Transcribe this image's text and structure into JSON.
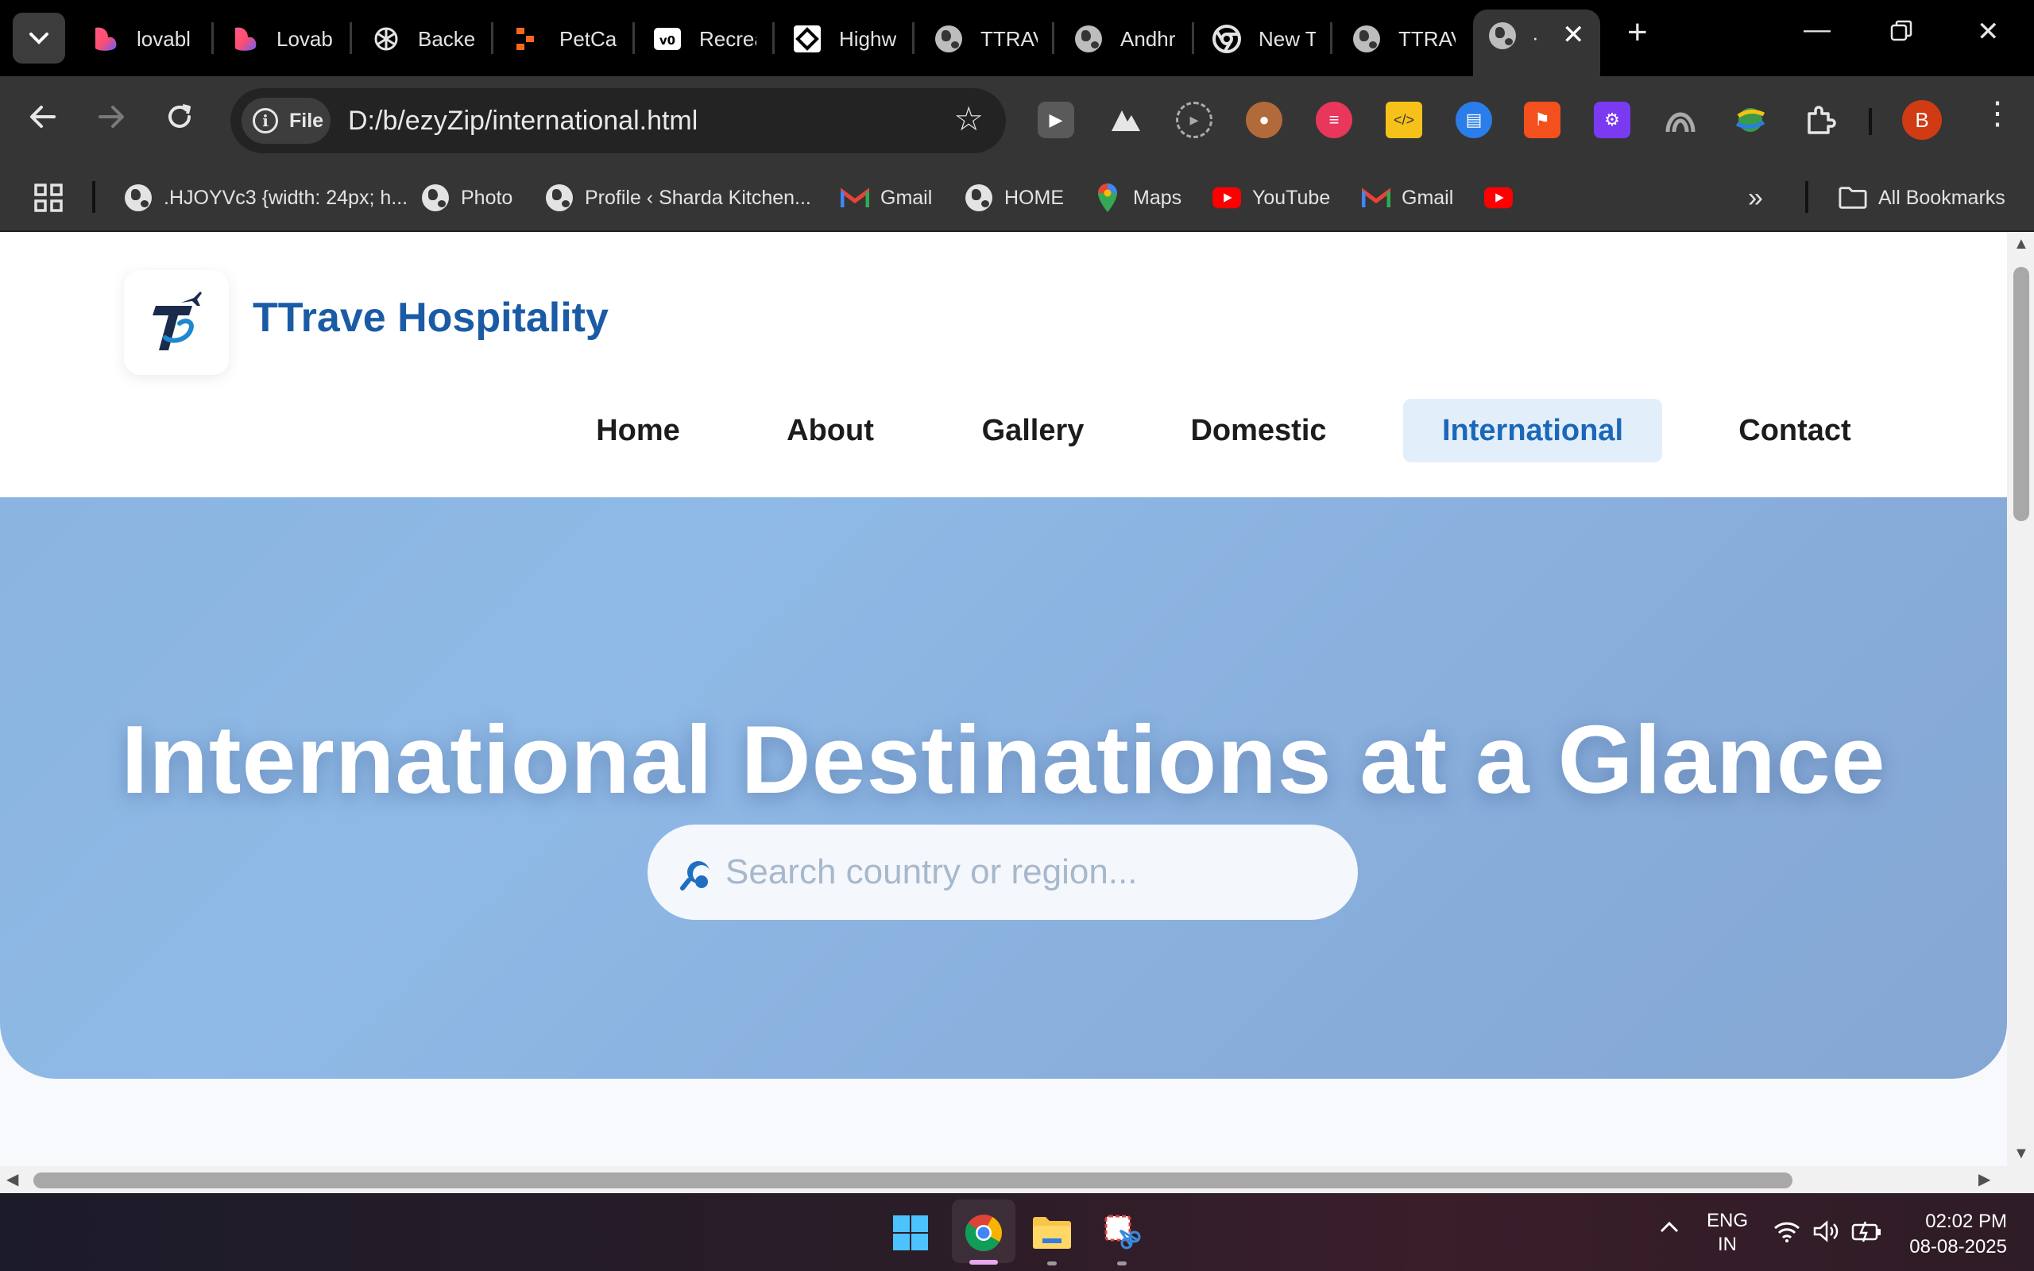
{
  "browser": {
    "tabs": [
      {
        "title": "lovabl",
        "icon": "lovable-icon"
      },
      {
        "title": "Lovab",
        "icon": "lovable-icon"
      },
      {
        "title": "Backe",
        "icon": "openai-icon"
      },
      {
        "title": "PetCa",
        "icon": "petcare-icon"
      },
      {
        "title": "Recrea",
        "icon": "v0-icon"
      },
      {
        "title": "Highw",
        "icon": "highway-icon"
      },
      {
        "title": "TTRAV",
        "icon": "globe-icon"
      },
      {
        "title": "Andhr",
        "icon": "globe-icon"
      },
      {
        "title": "New T",
        "icon": "chrome-icon"
      },
      {
        "title": "TTRAV",
        "icon": "globe-icon"
      },
      {
        "title": "·",
        "icon": "globe-icon"
      }
    ],
    "omnibox": {
      "chip_label": "File",
      "url": "D:/b/ezyZip/international.html"
    },
    "profile_initial": "B",
    "bookmarks": [
      {
        "label": ".HJOYVc3 {width: 24px; h...",
        "icon": "globe-icon"
      },
      {
        "label": "Photo",
        "icon": "globe-icon"
      },
      {
        "label": "Profile ‹ Sharda Kitchen...",
        "icon": "globe-icon"
      },
      {
        "label": "Gmail",
        "icon": "gmail-icon"
      },
      {
        "label": "HOME",
        "icon": "globe-icon"
      },
      {
        "label": "Maps",
        "icon": "maps-icon"
      },
      {
        "label": "YouTube",
        "icon": "youtube-icon"
      },
      {
        "label": "Gmail",
        "icon": "gmail-icon"
      },
      {
        "label": "",
        "icon": "youtube-icon"
      }
    ],
    "all_bookmarks_label": "All Bookmarks"
  },
  "site": {
    "brand": "TTrave Hospitality",
    "nav": [
      "Home",
      "About",
      "Gallery",
      "Domestic",
      "International",
      "Contact"
    ],
    "active_nav": "International",
    "hero_title": "International Destinations at a Glance",
    "search_placeholder": "Search country or region..."
  },
  "taskbar": {
    "lang_top": "ENG",
    "lang_bottom": "IN",
    "time": "02:02 PM",
    "date": "08-08-2025"
  },
  "colors": {
    "brand_blue": "#1b5ba6",
    "hero_blue": "#8bb4e0",
    "active_nav_bg": "#e3eefb"
  }
}
